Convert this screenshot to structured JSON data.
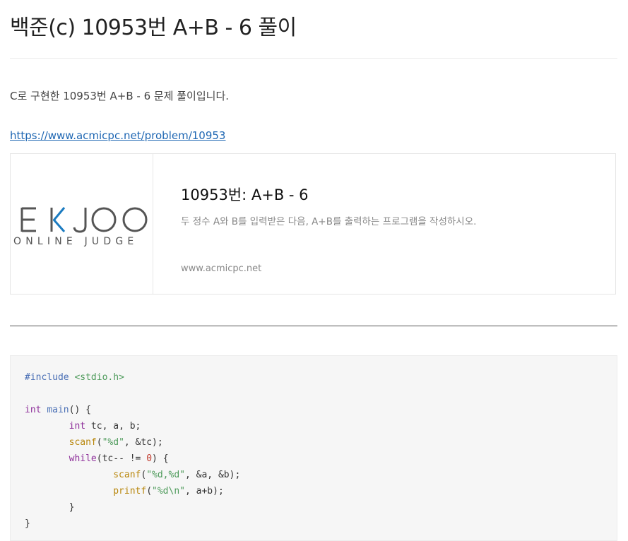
{
  "post": {
    "title": "백준(c) 10953번 A+B - 6 풀이",
    "intro": "C로 구현한 10953번 A+B - 6 문제 풀이입니다.",
    "link": "https://www.acmicpc.net/problem/10953"
  },
  "card": {
    "logo_word": "EKJOO",
    "logo_sub": "ONLINE JUDGE",
    "title": "10953번: A+B - 6",
    "description": "두 정수 A와 B를 입력받은 다음, A+B를 출력하는 프로그램을 작성하시오.",
    "domain": "www.acmicpc.net",
    "accent_color": "#1b7bc0"
  },
  "code": {
    "lines": [
      [
        {
          "t": "#include ",
          "c": "meta"
        },
        {
          "t": "<stdio.h>",
          "c": "inc"
        }
      ],
      [],
      [
        {
          "t": "int",
          "c": "kw"
        },
        {
          "t": " ",
          "c": "txt"
        },
        {
          "t": "main",
          "c": "meta"
        },
        {
          "t": "() {",
          "c": "txt"
        }
      ],
      [
        {
          "t": "        ",
          "c": "txt"
        },
        {
          "t": "int",
          "c": "kw"
        },
        {
          "t": " tc, a, b;",
          "c": "txt"
        }
      ],
      [
        {
          "t": "        ",
          "c": "txt"
        },
        {
          "t": "scanf",
          "c": "fn"
        },
        {
          "t": "(",
          "c": "txt"
        },
        {
          "t": "\"%d\"",
          "c": "str"
        },
        {
          "t": ", &tc);",
          "c": "txt"
        }
      ],
      [
        {
          "t": "        ",
          "c": "txt"
        },
        {
          "t": "while",
          "c": "kw"
        },
        {
          "t": "(tc-- != ",
          "c": "txt"
        },
        {
          "t": "0",
          "c": "num"
        },
        {
          "t": ") {",
          "c": "txt"
        }
      ],
      [
        {
          "t": "                ",
          "c": "txt"
        },
        {
          "t": "scanf",
          "c": "fn"
        },
        {
          "t": "(",
          "c": "txt"
        },
        {
          "t": "\"%d,%d\"",
          "c": "str"
        },
        {
          "t": ", &a, &b);",
          "c": "txt"
        }
      ],
      [
        {
          "t": "                ",
          "c": "txt"
        },
        {
          "t": "printf",
          "c": "fn"
        },
        {
          "t": "(",
          "c": "txt"
        },
        {
          "t": "\"%d\\n\"",
          "c": "str"
        },
        {
          "t": ", a+b);",
          "c": "txt"
        }
      ],
      [
        {
          "t": "        }",
          "c": "txt"
        }
      ],
      [
        {
          "t": "}",
          "c": "txt"
        }
      ]
    ]
  }
}
